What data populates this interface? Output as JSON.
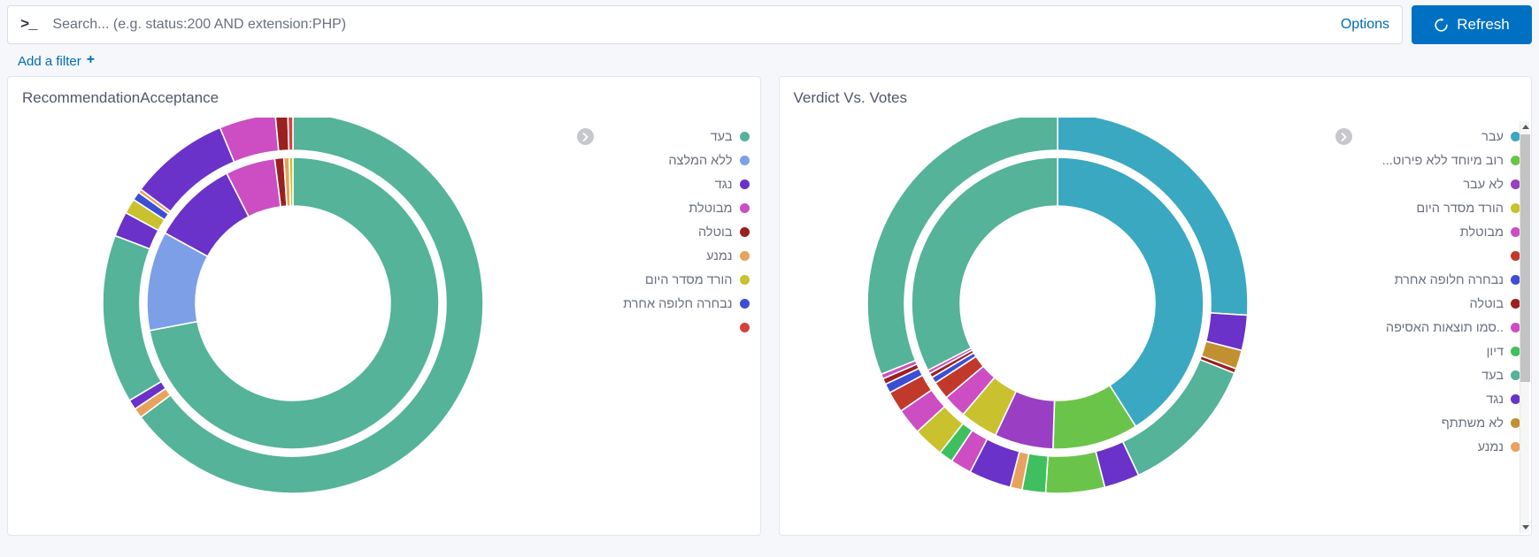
{
  "search": {
    "prompt_icon": "terminal-prompt-icon",
    "placeholder": "Search... (e.g. status:200 AND extension:PHP)",
    "value": "",
    "options_label": "Options"
  },
  "refresh": {
    "label": "Refresh",
    "icon": "refresh-icon",
    "color": "#0071c2"
  },
  "filters": {
    "add_label": "Add a filter",
    "plus_glyph": "+"
  },
  "panels": [
    {
      "title": "RecommendationAcceptance",
      "legend_has_scrollbar": false,
      "chart_data": {
        "type": "pie",
        "title": "RecommendationAcceptance",
        "variant": "sunburst-donut",
        "rings": 2,
        "legend_position": "right",
        "legend": [
          {
            "label": "בעד",
            "color": "#54b399"
          },
          {
            "label": "ללא המלצה",
            "color": "#7d9fe8"
          },
          {
            "label": "נגד",
            "color": "#6a32c9"
          },
          {
            "label": "מבוטלת",
            "color": "#cc4ec2"
          },
          {
            "label": "בוטלה",
            "color": "#9b2020"
          },
          {
            "label": "נמנע",
            "color": "#e7a35d"
          },
          {
            "label": "הורד מסדר היום",
            "color": "#c9c12e"
          },
          {
            "label": "נבחרה חלופה אחרת",
            "color": "#3c4fd4"
          },
          {
            "label": "",
            "color": "#d6413e"
          }
        ],
        "inner_ring": [
          {
            "name": "בעד",
            "color": "#54b399",
            "value": 72.0
          },
          {
            "name": "ללא המלצה",
            "color": "#7d9fe8",
            "value": 11.0
          },
          {
            "name": "נגד",
            "color": "#6a32c9",
            "value": 9.5
          },
          {
            "name": "מבוטלת",
            "color": "#cc4ec2",
            "value": 5.5
          },
          {
            "name": "בוטלה",
            "color": "#9b2020",
            "value": 1.0
          },
          {
            "name": "נמנע",
            "color": "#e7a35d",
            "value": 0.6
          },
          {
            "name": "הורד מסדר היום",
            "color": "#c9c12e",
            "value": 0.4
          }
        ],
        "outer_ring": [
          {
            "name": "בעד",
            "color": "#54b399",
            "value": 61.0
          },
          {
            "name": "נמנע",
            "color": "#e7a35d",
            "value": 0.8
          },
          {
            "name": "נגד",
            "color": "#6a32c9",
            "value": 0.8
          },
          {
            "name": "בעד",
            "color": "#54b399",
            "value": 13.5
          },
          {
            "name": "נגד",
            "color": "#6a32c9",
            "value": 2.0
          },
          {
            "name": "הורד מסדר היום",
            "color": "#c9c12e",
            "value": 1.2
          },
          {
            "name": "נבחרה חלופה אחרת",
            "color": "#3c4fd4",
            "value": 0.7
          },
          {
            "name": "נמנע",
            "color": "#e7a35d",
            "value": 0.3
          },
          {
            "name": "נגד",
            "color": "#6a32c9",
            "value": 8.0
          },
          {
            "name": "מבוטלת",
            "color": "#cc4ec2",
            "value": 4.5
          },
          {
            "name": "בוטלה",
            "color": "#9b2020",
            "value": 1.0
          },
          {
            "name": "",
            "color": "#d6413e",
            "value": 0.4
          }
        ]
      }
    },
    {
      "title": "Verdict Vs. Votes",
      "legend_has_scrollbar": true,
      "chart_data": {
        "type": "pie",
        "title": "Verdict Vs. Votes",
        "variant": "sunburst-donut",
        "rings": 2,
        "legend_position": "right",
        "legend": [
          {
            "label": "עבר",
            "color": "#3aa8c1"
          },
          {
            "label": "רוב מיוחד ללא פירוט...",
            "color": "#6bc44a"
          },
          {
            "label": "לא עבר",
            "color": "#9a3fc4"
          },
          {
            "label": "הורד מסדר היום",
            "color": "#c9c12e"
          },
          {
            "label": "מבוטלת",
            "color": "#cc4ec2"
          },
          {
            "label": "",
            "color": "#c0392b"
          },
          {
            "label": "נבחרה חלופה אחרת",
            "color": "#3c4fd4"
          },
          {
            "label": "בוטלה",
            "color": "#9b2020"
          },
          {
            "label": "..סמו תוצאות האסיפה",
            "color": "#cc4ec2"
          },
          {
            "label": "דיון",
            "color": "#3fbf5f"
          },
          {
            "label": "בעד",
            "color": "#54b399"
          },
          {
            "label": "נגד",
            "color": "#6a32c9"
          },
          {
            "label": "לא משתתף",
            "color": "#c19030"
          },
          {
            "label": "נמנע",
            "color": "#e7a35d"
          }
        ],
        "inner_ring": [
          {
            "name": "עבר",
            "color": "#3aa8c1",
            "value": 41.0
          },
          {
            "name": "רוב מיוחד ללא פירוט...",
            "color": "#6bc44a",
            "value": 9.5
          },
          {
            "name": "לא עבר",
            "color": "#9a3fc4",
            "value": 6.5
          },
          {
            "name": "הורד מסדר היום",
            "color": "#c9c12e",
            "value": 4.2
          },
          {
            "name": "מבוטלת",
            "color": "#cc4ec2",
            "value": 2.6
          },
          {
            "name": "",
            "color": "#c0392b",
            "value": 2.0
          },
          {
            "name": "נבחרה חלופה אחרת",
            "color": "#3c4fd4",
            "value": 0.7
          },
          {
            "name": "בוטלה",
            "color": "#9b2020",
            "value": 0.5
          },
          {
            "name": "..סמו תוצאות האסיפה",
            "color": "#cc4ec2",
            "value": 0.4
          },
          {
            "name": "בעד",
            "color": "#54b399",
            "value": 32.6
          }
        ],
        "outer_ring": [
          {
            "name": "עבר",
            "color": "#3aa8c1",
            "value": 26.0
          },
          {
            "name": "נגד",
            "color": "#6a32c9",
            "value": 3.0
          },
          {
            "name": "לא משתתף",
            "color": "#c19030",
            "value": 1.6
          },
          {
            "name": "בוטלה",
            "color": "#9b2020",
            "value": 0.4
          },
          {
            "name": "בעד",
            "color": "#54b399",
            "value": 12.0
          },
          {
            "name": "נגד",
            "color": "#6a32c9",
            "value": 3.0
          },
          {
            "name": "רוב מיוחד ללא פירוט...",
            "color": "#6bc44a",
            "value": 5.0
          },
          {
            "name": "דיון",
            "color": "#3fbf5f",
            "value": 2.0
          },
          {
            "name": "נמנע",
            "color": "#e7a35d",
            "value": 1.0
          },
          {
            "name": "נגד",
            "color": "#6a32c9",
            "value": 3.6
          },
          {
            "name": "מבוטלת",
            "color": "#cc4ec2",
            "value": 1.8
          },
          {
            "name": "דיון",
            "color": "#3fbf5f",
            "value": 1.2
          },
          {
            "name": "הורד מסדר היום",
            "color": "#c9c12e",
            "value": 2.6
          },
          {
            "name": "מבוטלת",
            "color": "#cc4ec2",
            "value": 2.2
          },
          {
            "name": "",
            "color": "#c0392b",
            "value": 1.8
          },
          {
            "name": "נבחרה חלופה אחרת",
            "color": "#3c4fd4",
            "value": 0.8
          },
          {
            "name": "בוטלה",
            "color": "#9b2020",
            "value": 0.5
          },
          {
            "name": "..סמו תוצאות האסיפה",
            "color": "#cc4ec2",
            "value": 0.4
          },
          {
            "name": "בעד",
            "color": "#54b399",
            "value": 31.1
          }
        ]
      }
    }
  ],
  "legend_toggle_icon": "chevron-right-circle-icon",
  "scrollbar": {
    "up_icon": "caret-up-icon",
    "down_icon": "caret-down-icon"
  }
}
